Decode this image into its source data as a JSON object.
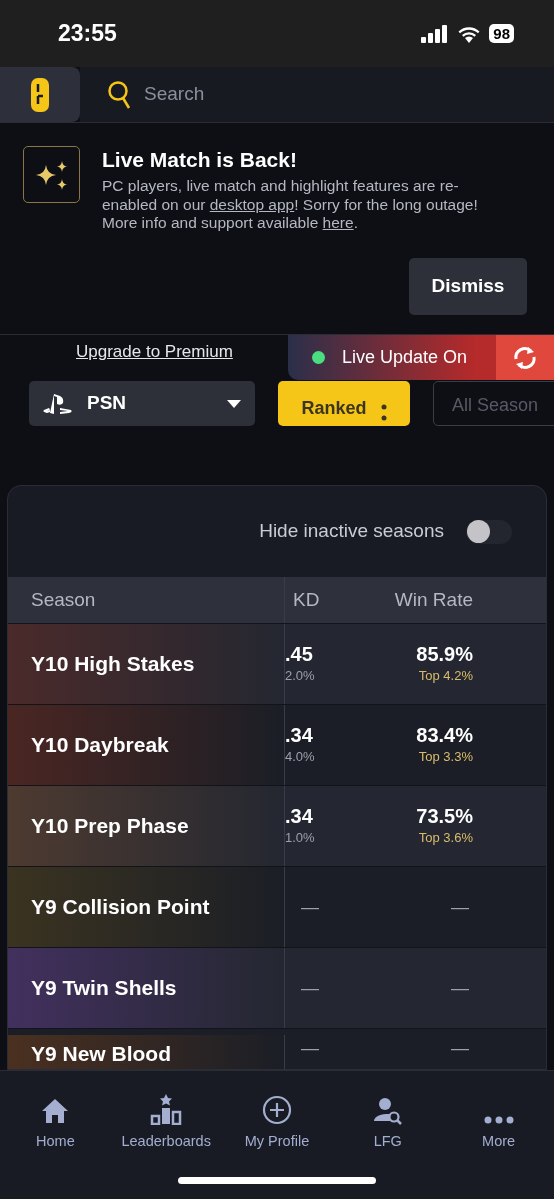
{
  "status_bar": {
    "time": "23:55",
    "battery": "98"
  },
  "header": {
    "search": {
      "placeholder": "Search"
    }
  },
  "banner": {
    "title": "Live Match is Back!",
    "text_parts": [
      "PC players, live match and highlight features are re-enabled on our ",
      "desktop app",
      "! Sorry for the long outage! More info and support available ",
      "here",
      "."
    ],
    "dismiss": "Dismiss"
  },
  "upgrade_link": "Upgrade to Premium",
  "filters": {
    "platform": "PSN",
    "mode": "Ranked",
    "season": "All Season"
  },
  "live_toast": {
    "label": "Live Update On"
  },
  "card": {
    "toggle": {
      "label": "Hide inactive seasons",
      "on": false
    },
    "columns": [
      "Season",
      "KD",
      "Win Rate"
    ],
    "rows": [
      {
        "season": "Y10 High Stakes",
        "color": "#4a2a2a",
        "kd": ".45",
        "kd_sub": "2.0%",
        "win_rate": "85.9%",
        "win_sub": "Top 4.2%"
      },
      {
        "season": "Y10 Daybreak",
        "color": "#4a2622",
        "kd": ".34",
        "kd_sub": "4.0%",
        "win_rate": "83.4%",
        "win_sub": "Top 3.3%"
      },
      {
        "season": "Y10 Prep Phase",
        "color": "#4d3a30",
        "kd": ".34",
        "kd_sub": "1.0%",
        "win_rate": "73.5%",
        "win_sub": "Top 3.6%"
      },
      {
        "season": "Y9 Collision Point",
        "color": "#3a3320",
        "kd": "—",
        "win_rate": "—"
      },
      {
        "season": "Y9 Twin Shells",
        "color": "#42305e",
        "kd": "—",
        "win_rate": "—"
      },
      {
        "season": "Y9 New Blood",
        "color": "#4a3020",
        "kd": "—",
        "win_rate": "—"
      }
    ]
  },
  "nav": [
    {
      "label": "Home",
      "kind": "home"
    },
    {
      "label": "Leaderboards",
      "kind": "leaderboards"
    },
    {
      "label": "My Profile",
      "kind": "profile"
    },
    {
      "label": "LFG",
      "kind": "lfg"
    },
    {
      "label": "More",
      "kind": "more"
    }
  ]
}
